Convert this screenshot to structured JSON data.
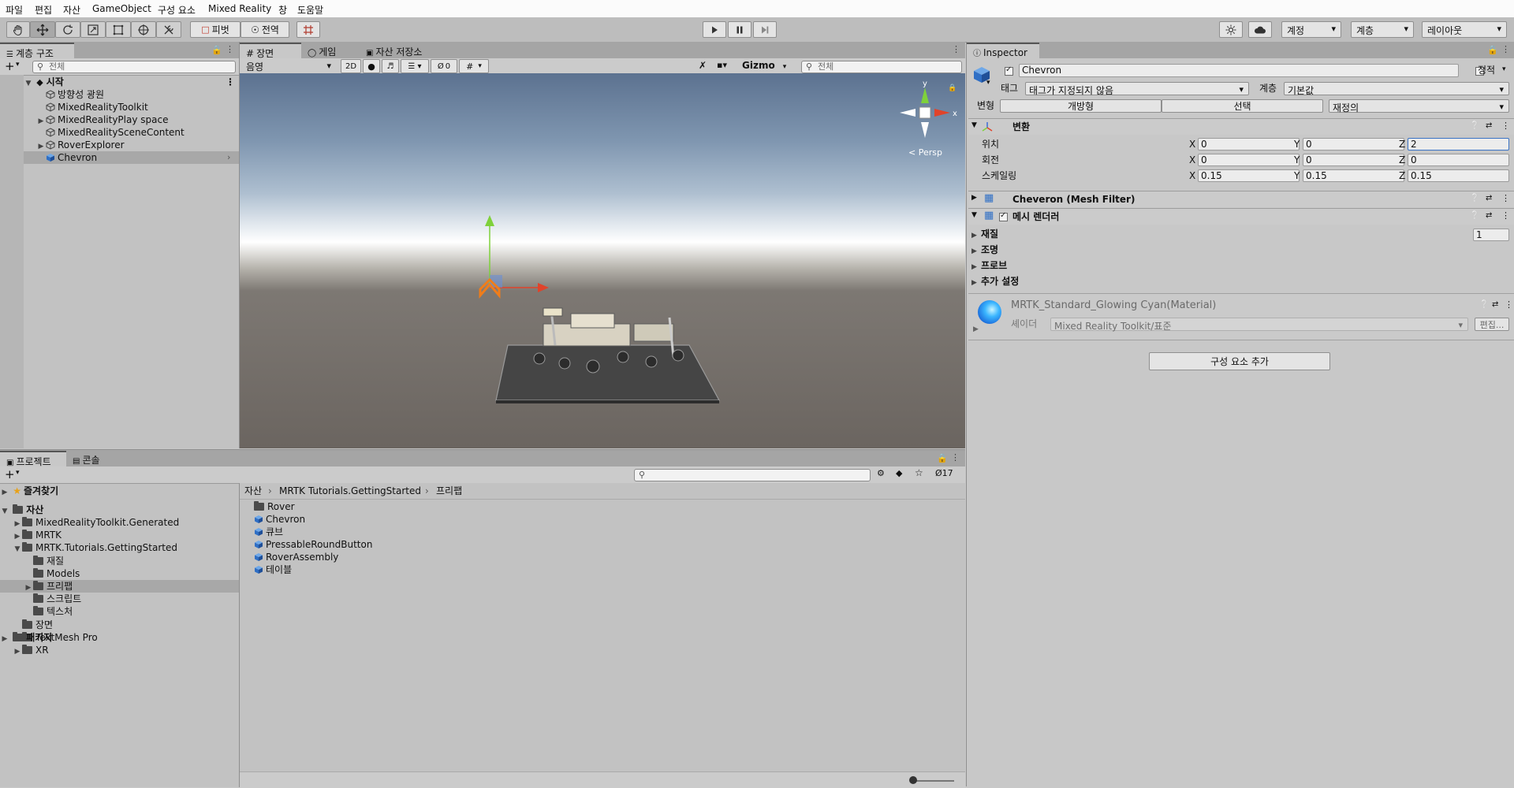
{
  "menu": [
    "파일",
    "편집",
    "자산",
    "GameObject",
    "구성 요소",
    "Mixed Reality",
    "창",
    "도움말"
  ],
  "toolbar": {
    "pivot_label": "피벗",
    "global_label": "전역",
    "account_label": "계정",
    "layers_label": "계층",
    "layout_label": "레이아웃",
    "icons": [
      "hand-icon",
      "move-icon",
      "rotate-icon",
      "scale-icon",
      "rect-icon",
      "transform-icon",
      "custom-tool-icon",
      "grid-snap-icon",
      "play-icon",
      "pause-icon",
      "step-icon",
      "collab-icon",
      "cloud-icon"
    ]
  },
  "hierarchy": {
    "tab": "계층 구조",
    "search_placeholder": "전체",
    "scene": "시작",
    "items": [
      {
        "label": "방향성 광원",
        "expandable": false,
        "selected": false
      },
      {
        "label": "MixedRealityToolkit",
        "expandable": false,
        "selected": false
      },
      {
        "label": "MixedRealityPlay space",
        "expandable": true,
        "selected": false
      },
      {
        "label": "MixedRealitySceneContent",
        "expandable": false,
        "selected": false
      },
      {
        "label": "RoverExplorer",
        "expandable": true,
        "selected": false
      },
      {
        "label": "Chevron",
        "expandable": false,
        "selected": true
      }
    ]
  },
  "scene": {
    "tabs": [
      "장면",
      "게임",
      "자산 저장소"
    ],
    "shading": "음영",
    "mode2d": "2D",
    "hidden_count": "0",
    "gizmo_label": "Gizmo",
    "search_placeholder": "전체",
    "persp_label": "< Persp",
    "axis_y": "y",
    "axis_x": "x"
  },
  "project": {
    "tabs": [
      "프로젝트",
      "콘솔"
    ],
    "hidden_count": "17",
    "favorites": "즐겨찾기",
    "assets": "자산",
    "tree": [
      {
        "label": "MixedRealityToolkit.Generated",
        "level": 1,
        "expandable": true,
        "expanded": false,
        "selected": false
      },
      {
        "label": "MRTK",
        "level": 1,
        "expandable": true,
        "expanded": false,
        "selected": false
      },
      {
        "label": "MRTK.Tutorials.GettingStarted",
        "level": 1,
        "expandable": true,
        "expanded": true,
        "selected": false
      },
      {
        "label": "재질",
        "level": 2,
        "expandable": false,
        "expanded": false,
        "selected": false
      },
      {
        "label": "Models",
        "level": 2,
        "expandable": false,
        "expanded": false,
        "selected": false
      },
      {
        "label": "프리팹",
        "level": 2,
        "expandable": true,
        "expanded": false,
        "selected": true
      },
      {
        "label": "스크립트",
        "level": 2,
        "expandable": false,
        "expanded": false,
        "selected": false
      },
      {
        "label": "텍스처",
        "level": 2,
        "expandable": false,
        "expanded": false,
        "selected": false
      },
      {
        "label": "장면",
        "level": 1,
        "expandable": false,
        "expanded": false,
        "selected": false
      },
      {
        "label": "TextMesh Pro",
        "level": 1,
        "expandable": true,
        "expanded": false,
        "selected": false
      },
      {
        "label": "XR",
        "level": 1,
        "expandable": true,
        "expanded": false,
        "selected": false
      }
    ],
    "packages": "패키지",
    "breadcrumb": [
      "자산",
      "MRTK Tutorials.GettingStarted",
      "프리팹"
    ],
    "files": [
      {
        "label": "Rover",
        "kind": "folder"
      },
      {
        "label": "Chevron",
        "kind": "prefab"
      },
      {
        "label": "큐브",
        "kind": "prefab"
      },
      {
        "label": "PressableRoundButton",
        "kind": "prefab"
      },
      {
        "label": "RoverAssembly",
        "kind": "prefab"
      },
      {
        "label": "테이블",
        "kind": "prefab"
      }
    ]
  },
  "inspector": {
    "tab": "Inspector",
    "object_name": "Chevron",
    "static_label": "정적",
    "tag_label": "태그",
    "tag_value": "태그가 지정되지 않음",
    "layer_label": "계층",
    "layer_value": "기본값",
    "variant_label": "변형",
    "variant_buttons": [
      "개방형",
      "선택",
      "재정의"
    ],
    "transform": {
      "title": "변환",
      "position_label": "위치",
      "rotation_label": "회전",
      "scale_label": "스케일링",
      "axis_labels": [
        "X",
        "Y",
        "Z"
      ],
      "position": [
        "0",
        "0",
        "2"
      ],
      "rotation": [
        "0",
        "0",
        "0"
      ],
      "scale": [
        "0.15",
        "0.15",
        "0.15"
      ]
    },
    "mesh_filter_title": "Cheveron (Mesh Filter)",
    "mesh_renderer_title": "메시 렌더러",
    "renderer_sections": [
      "재질",
      "조명",
      "프로브",
      "추가 설정"
    ],
    "materials_count": "1",
    "material_name": "MRTK_Standard_Glowing Cyan(Material)",
    "shader_label": "셰이더",
    "shader_value": "Mixed Reality Toolkit/표준",
    "edit_label": "편집...",
    "add_component": "구성 요소 추가"
  },
  "colors": {
    "accent_blue": "#3d7fd6",
    "gizmo_red": "#e0432a",
    "gizmo_green": "#7fd13b",
    "gizmo_blue": "#3d6bd6",
    "selection_orange": "#f07d1a"
  }
}
